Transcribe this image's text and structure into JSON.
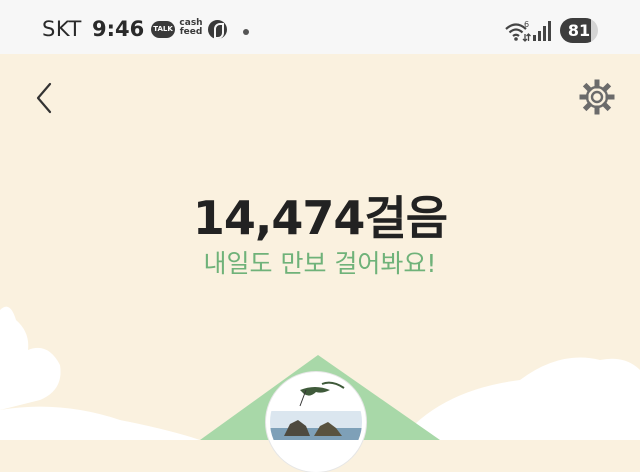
{
  "status_bar": {
    "carrier": "SKT",
    "time": "9:46",
    "talk_label": "TALK",
    "cashfeed_line1": "cash",
    "cashfeed_line2": "feed",
    "wifi_label": "6",
    "battery": "81",
    "battery_level": 0.81
  },
  "main": {
    "steps": "14,474걸음",
    "message": "내일도 만보 걸어봐요!"
  },
  "colors": {
    "background": "#faf1df",
    "accent_green": "#6fb279",
    "hill_green": "#a8d8a8"
  }
}
